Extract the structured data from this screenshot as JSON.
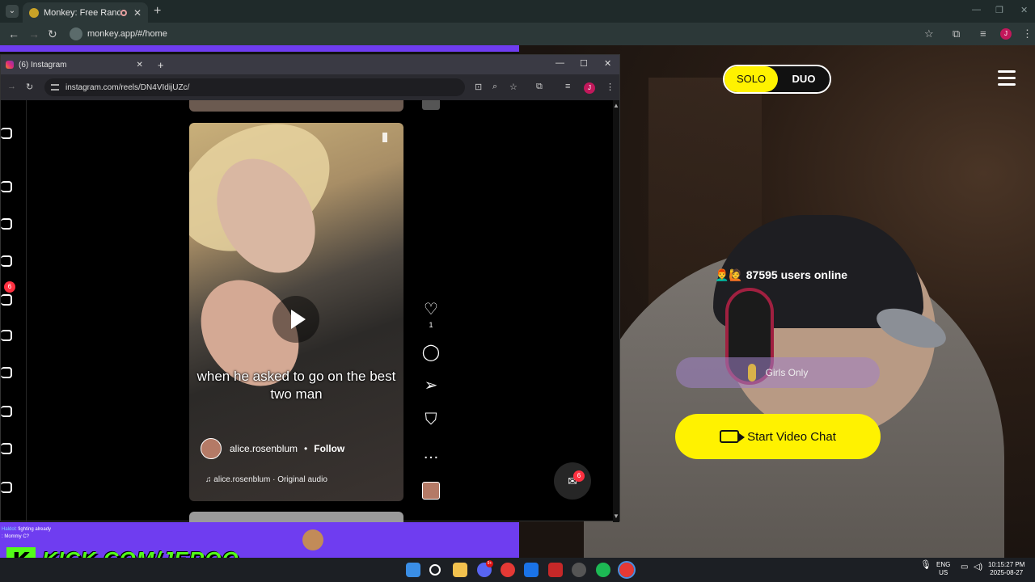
{
  "outer_browser": {
    "tab_title": "Monkey: Free Random Vide",
    "url": "monkey.app/#/home",
    "profile_initial": "J"
  },
  "monkey": {
    "mode_solo": "SOLO",
    "mode_duo": "DUO",
    "users_online": "87595 users online",
    "girls_only": "Girls Only",
    "start_chat": "Start Video Chat",
    "accent_color": "#fff200"
  },
  "instagram_window": {
    "tab_title": "(6) Instagram",
    "url": "instagram.com/reels/DN4VIdijUZc/",
    "profile_initial": "J",
    "nav_badge": "6",
    "reel": {
      "caption": "when he asked to go on the best two man",
      "username": "alice.rosenblum",
      "separator": "•",
      "follow": "Follow",
      "audio": "alice.rosenblum · Original audio",
      "like_count": "1"
    },
    "messages_badge": "6"
  },
  "stream_overlay": {
    "chat": [
      {
        "user": "Haldol",
        "text": ": fighting already"
      },
      {
        "user": "",
        "text": ": Mommy C?"
      }
    ],
    "kick_logo_letter": "K",
    "kick_url": "KICK.COM/JERQO",
    "brand_color": "#53fc18"
  },
  "taskbar": {
    "lang_top": "ENG",
    "lang_bottom": "US",
    "time": "10:15:27 PM",
    "date": "2025-08-27",
    "discord_badge": "9+"
  }
}
